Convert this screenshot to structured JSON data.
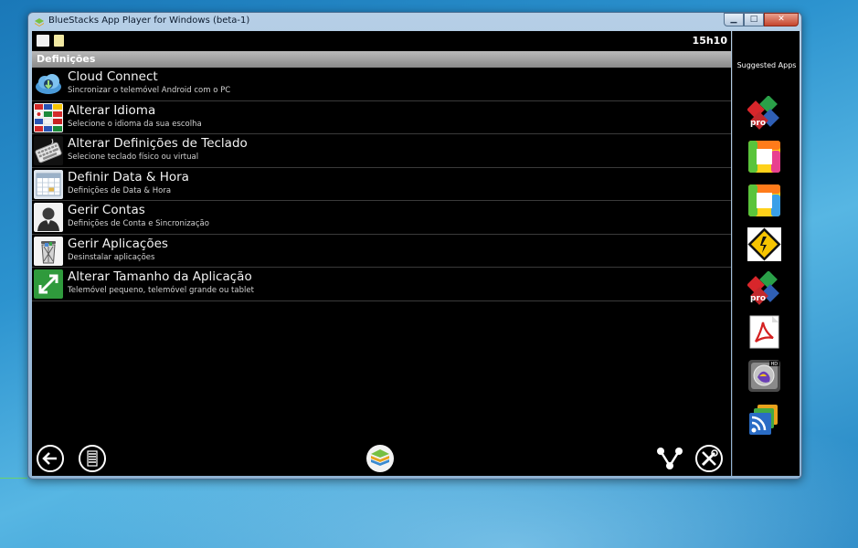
{
  "window": {
    "title": "BlueStacks App Player for Windows (beta-1)",
    "controls": {
      "minimize": "▁",
      "maximize": "□",
      "close": "✕"
    }
  },
  "status_bar": {
    "time": "15h10"
  },
  "section": {
    "title": "Definições"
  },
  "settings_items": [
    {
      "title": "Cloud Connect",
      "subtitle": "Sincronizar o telemóvel Android com o PC",
      "icon": "cloud-icon"
    },
    {
      "title": "Alterar Idioma",
      "subtitle": "Selecione o idioma da sua escolha",
      "icon": "flags-icon"
    },
    {
      "title": "Alterar Definições de Teclado",
      "subtitle": "Selecione teclado físico ou virtual",
      "icon": "keyboard-icon"
    },
    {
      "title": "Definir Data & Hora",
      "subtitle": "Definições de Data & Hora",
      "icon": "calendar-icon"
    },
    {
      "title": "Gerir Contas",
      "subtitle": "Definições de Conta e Sincronização",
      "icon": "account-icon"
    },
    {
      "title": "Gerir Aplicações",
      "subtitle": "Desinstalar aplicações",
      "icon": "trash-icon"
    },
    {
      "title": "Alterar Tamanho da Aplicação",
      "subtitle": "Telemóvel pequeno, telemóvel grande ou tablet",
      "icon": "resize-icon"
    }
  ],
  "sidebar": {
    "title": "Suggested Apps",
    "apps": [
      {
        "icon": "officesuite-pro-icon"
      },
      {
        "icon": "square-app-icon"
      },
      {
        "icon": "square-app-icon-2"
      },
      {
        "icon": "road-sign-icon"
      },
      {
        "icon": "officesuite-pro-icon-2"
      },
      {
        "icon": "pdf-icon"
      },
      {
        "icon": "photo-pro-icon"
      },
      {
        "icon": "rss-icon"
      }
    ]
  },
  "nav": {
    "back": "back-icon",
    "menu": "menu-icon",
    "home": "bluestacks-home-icon",
    "share": "share-icon",
    "settings": "tools-icon"
  }
}
